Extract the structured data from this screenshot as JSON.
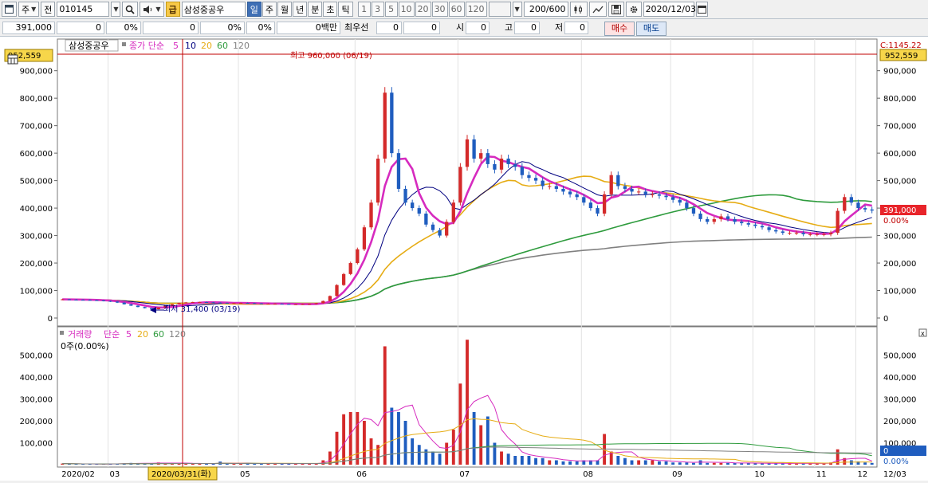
{
  "toolbar": {
    "period_label": "주",
    "mode_label": "전",
    "code": "010145",
    "gold_label": "급",
    "stock_name": "삼성중공우",
    "period_tabs": [
      "일",
      "주",
      "월",
      "년",
      "분",
      "초",
      "틱"
    ],
    "active_tab": "일",
    "interval_nums": [
      "1",
      "3",
      "5",
      "10",
      "20",
      "30",
      "60",
      "120"
    ],
    "count_display": "200/600",
    "date": "2020/12/03"
  },
  "infobar": {
    "price": "391,000",
    "change": "0",
    "change_pct": "0%",
    "change2": "0",
    "change2_pct": "0%",
    "change3": "0",
    "change3_pct": "0%",
    "volume_label": "0백만",
    "priority_label": "최우선",
    "bid": "0",
    "ask": "0",
    "open_label": "시",
    "open_val": "0",
    "high_label": "고",
    "high_val": "0",
    "low_label": "저",
    "low_val": "0",
    "buy_label": "매수",
    "sell_label": "매도"
  },
  "colors": {
    "ma5": "#d62bbf",
    "ma10": "#000080",
    "ma20": "#e6ac14",
    "ma60": "#2e9b3d",
    "ma120": "#808080",
    "up": "#d42a2a",
    "down": "#1f5dbf",
    "marker": "#c00000"
  },
  "price_panel": {
    "legend_name": "삼성중공우",
    "legend_ma_label": "종가 단순",
    "legend_periods": [
      "5",
      "10",
      "20",
      "60",
      "120"
    ],
    "left_top_box": "952,559",
    "right_top_box": "952,559",
    "right_top_label": "C:1145.22",
    "current_price_box": "391,000",
    "current_pct": "0.00%",
    "high_annot": "최고 960,000 (06/19)",
    "low_annot": "최저 31,400 (03/19)",
    "y_ticks": [
      "900,000",
      "800,000",
      "700,000",
      "600,000",
      "500,000",
      "400,000",
      "300,000",
      "200,000",
      "100,000",
      "0"
    ]
  },
  "volume_panel": {
    "legend_label": "거래량",
    "legend_ma_label": "단순",
    "legend_periods": [
      "5",
      "20",
      "60",
      "120"
    ],
    "summary": "0주(0.00%)",
    "right_box": "0",
    "right_pct": "0.00%",
    "y_ticks": [
      "500,000",
      "400,000",
      "300,000",
      "200,000",
      "100,000"
    ]
  },
  "x_axis": {
    "labels": [
      "2020/02",
      "03",
      "05",
      "06",
      "07",
      "08",
      "09",
      "10",
      "11",
      "12",
      "12/03"
    ],
    "cursor_date": "2020/03/31(화)"
  },
  "chart_data": {
    "type": "candlestick",
    "ylim": [
      0,
      960000
    ],
    "volume_ylim": [
      0,
      600000
    ],
    "close": [
      68000,
      67000,
      66500,
      66000,
      65000,
      64000,
      62000,
      60000,
      56000,
      50000,
      45000,
      40000,
      36000,
      32000,
      38000,
      45000,
      50000,
      55000,
      57000,
      58000,
      58000,
      57000,
      56000,
      55000,
      54000,
      54000,
      55000,
      54000,
      53000,
      52000,
      52000,
      52000,
      51000,
      50000,
      50000,
      50500,
      51000,
      54000,
      62000,
      80000,
      120000,
      160000,
      200000,
      250000,
      330000,
      420000,
      580000,
      820000,
      600000,
      470000,
      420000,
      400000,
      380000,
      340000,
      320000,
      300000,
      350000,
      420000,
      550000,
      650000,
      580000,
      600000,
      560000,
      540000,
      580000,
      560000,
      550000,
      520000,
      510000,
      500000,
      480000,
      480000,
      470000,
      460000,
      450000,
      440000,
      420000,
      400000,
      380000,
      450000,
      520000,
      480000,
      470000,
      460000,
      460000,
      450000,
      450000,
      445000,
      440000,
      430000,
      420000,
      400000,
      380000,
      360000,
      350000,
      360000,
      370000,
      360000,
      350000,
      345000,
      340000,
      335000,
      330000,
      320000,
      315000,
      310000,
      310000,
      310000,
      305000,
      305000,
      305000,
      305000,
      310000,
      390000,
      440000,
      420000,
      400000,
      395000,
      391000
    ],
    "volume": [
      5000,
      4000,
      3000,
      3000,
      3000,
      3000,
      3000,
      4000,
      5000,
      6000,
      8000,
      6000,
      7000,
      5000,
      10000,
      8000,
      6000,
      7000,
      5000,
      5000,
      6000,
      5000,
      5000,
      14000,
      5000,
      5000,
      5000,
      8000,
      5000,
      5000,
      5000,
      6000,
      5000,
      5000,
      5000,
      5000,
      5000,
      5000,
      20000,
      60000,
      150000,
      230000,
      240000,
      240000,
      200000,
      120000,
      90000,
      540000,
      260000,
      240000,
      200000,
      120000,
      90000,
      70000,
      60000,
      50000,
      100000,
      160000,
      370000,
      570000,
      240000,
      180000,
      220000,
      100000,
      60000,
      50000,
      40000,
      40000,
      40000,
      30000,
      30000,
      20000,
      20000,
      15000,
      15000,
      15000,
      20000,
      20000,
      20000,
      140000,
      60000,
      40000,
      30000,
      20000,
      20000,
      20000,
      20000,
      15000,
      15000,
      10000,
      10000,
      10000,
      8000,
      20000,
      8000,
      8000,
      8000,
      8000,
      8000,
      7000,
      7000,
      7000,
      6000,
      6000,
      6000,
      6000,
      6000,
      6000,
      6000,
      6000,
      6000,
      6000,
      10000,
      70000,
      30000,
      20000,
      15000,
      10000,
      8000
    ],
    "ma5": [
      68000,
      67500,
      67200,
      66900,
      66500,
      65700,
      64700,
      63400,
      61200,
      58400,
      54600,
      50200,
      45400,
      40600,
      38200,
      38200,
      40200,
      44000,
      49000,
      53000,
      55600,
      57000,
      57200,
      56800,
      56000,
      55200,
      54800,
      54400,
      54000,
      53600,
      53200,
      52600,
      52400,
      51800,
      51400,
      50700,
      50500,
      51100,
      53500,
      59500,
      73400,
      95200,
      124400,
      162000,
      212000,
      276000,
      356000,
      480000,
      550000,
      578000,
      580000,
      542000,
      454000,
      402000,
      372000,
      352000,
      342000,
      346000,
      388000,
      454000,
      510000,
      560000,
      588000,
      586000,
      572000,
      568000,
      558000,
      550000,
      544000,
      528000,
      512000,
      498000,
      488000,
      478000,
      468000,
      460000,
      448000,
      434000,
      418000,
      420000,
      438000,
      444000,
      460000,
      476000,
      478000,
      468000,
      462000,
      457000,
      451000,
      443000,
      437000,
      427000,
      414000,
      398000,
      382000,
      372000,
      364000,
      358000,
      356000,
      355000,
      353000,
      348000,
      344000,
      338000,
      330000,
      324000,
      319000,
      315000,
      312000,
      309000,
      307000,
      306000,
      307000,
      323000,
      352000,
      373000,
      393000,
      413000,
      409000
    ]
  }
}
